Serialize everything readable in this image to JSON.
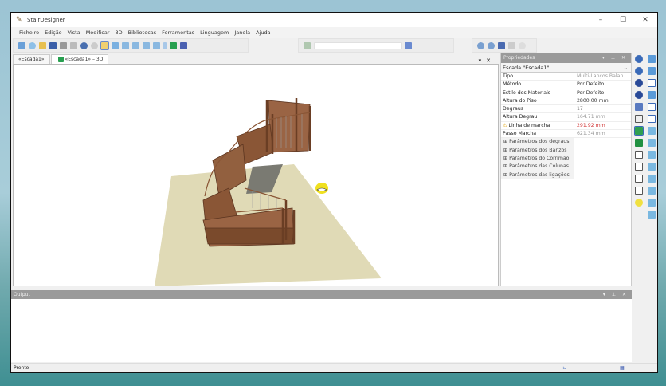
{
  "window": {
    "title": "StairDesigner",
    "minimize": "–",
    "maximize": "☐",
    "close": "✕"
  },
  "menu": [
    "Ficheiro",
    "Edição",
    "Vista",
    "Modificar",
    "3D",
    "Bibliotecas",
    "Ferramentas",
    "Linguagem",
    "Janela",
    "Ajuda"
  ],
  "tabs": [
    {
      "label": "«Escada1»"
    },
    {
      "label": "«Escada1» – 3D"
    }
  ],
  "properties": {
    "title": "Propriedades",
    "selected": "Escada \"Escada1\"",
    "rows": [
      {
        "key": "Tipo",
        "value": "Multi-Lanços Balan..."
      },
      {
        "key": "Método",
        "value": "Por Defeito"
      },
      {
        "key": "Estilo dos Materiais",
        "value": "Por Defeito"
      },
      {
        "key": "Altura do Piso",
        "value": "2800.00 mm"
      },
      {
        "key": "Degraus",
        "value": "17"
      },
      {
        "key": "Altura Degrau",
        "value": "164.71 mm"
      },
      {
        "key": "Linha de marcha",
        "value": "291.92 mm",
        "warning": true
      },
      {
        "key": "Passo Marcha",
        "value": "621.34 mm"
      }
    ],
    "groups": [
      "Parâmetros dos degraus",
      "Parâmetros dos Banzos",
      "Parâmetros do Corrimão",
      "Parâmetros das Colunas",
      "Parâmetros das ligações"
    ]
  },
  "output": {
    "title": "Output"
  },
  "status": {
    "text": "Pronto"
  },
  "colors": {
    "floor": "#e0dab6",
    "wood": "#8a5636",
    "warning": "#d03030"
  }
}
